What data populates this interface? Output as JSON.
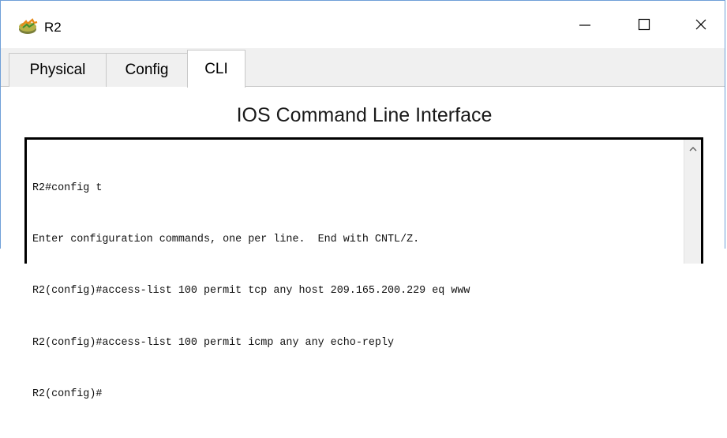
{
  "window": {
    "title": "R2",
    "app_icon": "router-device-icon",
    "controls": {
      "minimize": "minimize-icon",
      "maximize": "maximize-icon",
      "close": "close-icon"
    }
  },
  "tabs": [
    {
      "label": "Physical",
      "active": false
    },
    {
      "label": "Config",
      "active": false
    },
    {
      "label": "CLI",
      "active": true
    }
  ],
  "cli": {
    "heading": "IOS Command Line Interface",
    "lines": [
      "R2#config t",
      "Enter configuration commands, one per line.  End with CNTL/Z.",
      "R2(config)#access-list 100 permit tcp any host 209.165.200.229 eq www",
      "R2(config)#access-list 100 permit icmp any any echo-reply",
      "R2(config)#"
    ]
  },
  "colors": {
    "border_accent": "#6f9fd8",
    "tab_bg": "#f0f0f0"
  }
}
